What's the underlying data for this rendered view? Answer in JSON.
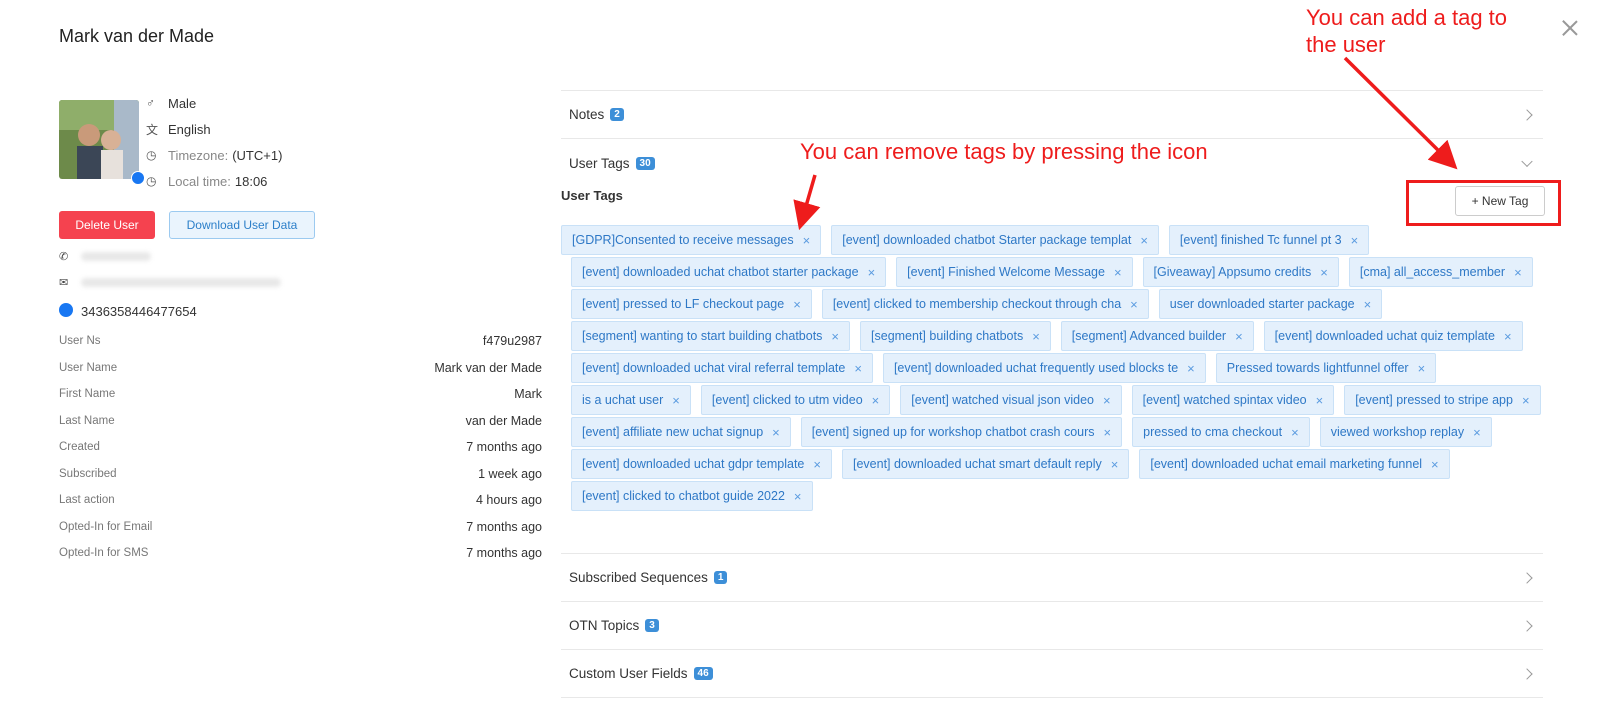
{
  "title": "Mark van der Made",
  "profile": {
    "gender": "Male",
    "language": "English",
    "timezone_label": "Timezone:",
    "timezone": "(UTC+1)",
    "localtime_label": "Local time:",
    "localtime": "18:06"
  },
  "actions": {
    "delete": "Delete User",
    "download": "Download User Data"
  },
  "messenger_id": "3436358446477654",
  "fields": [
    {
      "k": "User Ns",
      "v": "f479u2987"
    },
    {
      "k": "User Name",
      "v": "Mark van der Made"
    },
    {
      "k": "First Name",
      "v": "Mark"
    },
    {
      "k": "Last Name",
      "v": "van der Made"
    },
    {
      "k": "Created",
      "v": "7 months ago"
    },
    {
      "k": "Subscribed",
      "v": "1 week ago"
    },
    {
      "k": "Last action",
      "v": "4 hours ago"
    },
    {
      "k": "Opted-In for Email",
      "v": "7 months ago"
    },
    {
      "k": "Opted-In for SMS",
      "v": "7 months ago"
    }
  ],
  "sections": {
    "notes": {
      "label": "Notes",
      "count": "2"
    },
    "user_tags": {
      "label": "User Tags",
      "count": "30"
    },
    "sequences": {
      "label": "Subscribed Sequences",
      "count": "1"
    },
    "otn": {
      "label": "OTN Topics",
      "count": "3"
    },
    "custom_fields": {
      "label": "Custom User Fields",
      "count": "46"
    }
  },
  "tags_header": "User Tags",
  "new_tag": "+ New Tag",
  "tag_rows": [
    [
      "[GDPR]Consented to receive messages",
      "[event] downloaded chatbot Starter package templat",
      "[event] finished Tc funnel pt 3"
    ],
    [
      "[event] downloaded uchat chatbot starter package",
      "[event] Finished Welcome Message",
      "[Giveaway] Appsumo credits",
      "[cma] all_access_member"
    ],
    [
      "[event] pressed to LF checkout page",
      "[event] clicked to membership checkout through cha",
      "user downloaded starter package"
    ],
    [
      "[segment] wanting to start building chatbots",
      "[segment] building chatbots",
      "[segment] Advanced builder",
      "[event] downloaded uchat quiz template"
    ],
    [
      "[event] downloaded uchat viral referral template",
      "[event] downloaded uchat frequently used blocks te",
      "Pressed towards lightfunnel offer"
    ],
    [
      "is a uchat user",
      "[event] clicked to utm video",
      "[event] watched visual json video",
      "[event] watched spintax video",
      "[event] pressed to stripe app"
    ],
    [
      "[event] affiliate new uchat signup",
      "[event] signed up for workshop chatbot crash cours",
      "pressed to cma checkout",
      "viewed workshop replay"
    ],
    [
      "[event] downloaded uchat gdpr template",
      "[event] downloaded uchat smart default reply",
      "[event] downloaded uchat email marketing funnel"
    ],
    [
      "[event] clicked to chatbot guide 2022"
    ]
  ],
  "annotations": {
    "add_tag_line1": "You can add a tag to",
    "add_tag_line2": "the user",
    "remove_tags": "You can remove tags by pressing the icon"
  },
  "colors": {
    "accent": "#3d8fd8",
    "delete": "#f5424f",
    "annotation": "#ee1c1c",
    "tag_bg": "#e4f0fc"
  }
}
